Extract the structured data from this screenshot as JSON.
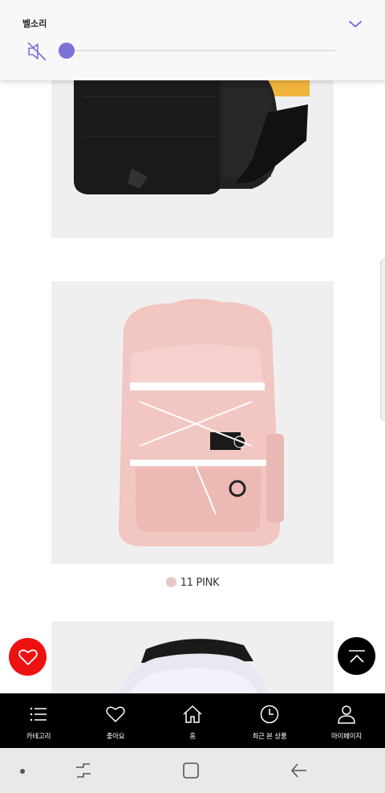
{
  "volume_panel": {
    "title": "벨소리",
    "level": 0,
    "muted": true,
    "icons": {
      "mute": "speaker-muted-icon",
      "collapse": "chevron-down-icon"
    },
    "accent_color": "#7b72d6"
  },
  "products": [
    {
      "id": "yellow-black",
      "image": "backpack-yellow-black"
    },
    {
      "id": "pink",
      "image": "backpack-pink",
      "color_swatch": "#e8c8c4",
      "color_label": "11 PINK"
    },
    {
      "id": "white",
      "image": "backpack-white"
    }
  ],
  "fab": {
    "like": {
      "icon": "heart-icon",
      "color": "#ee1111"
    },
    "top": {
      "icon": "scroll-to-top-icon",
      "color": "#000000"
    }
  },
  "tab_bar": {
    "items": [
      {
        "label": "카테고리",
        "icon": "menu-icon"
      },
      {
        "label": "좋아요",
        "icon": "heart-outline-icon"
      },
      {
        "label": "홈",
        "icon": "home-icon"
      },
      {
        "label": "최근 본 상품",
        "icon": "clock-icon"
      },
      {
        "label": "마이페이지",
        "icon": "person-icon"
      }
    ]
  },
  "nav_bar": {
    "buttons": [
      "recent-apps-icon",
      "home-square-icon",
      "back-arrow-icon"
    ]
  }
}
